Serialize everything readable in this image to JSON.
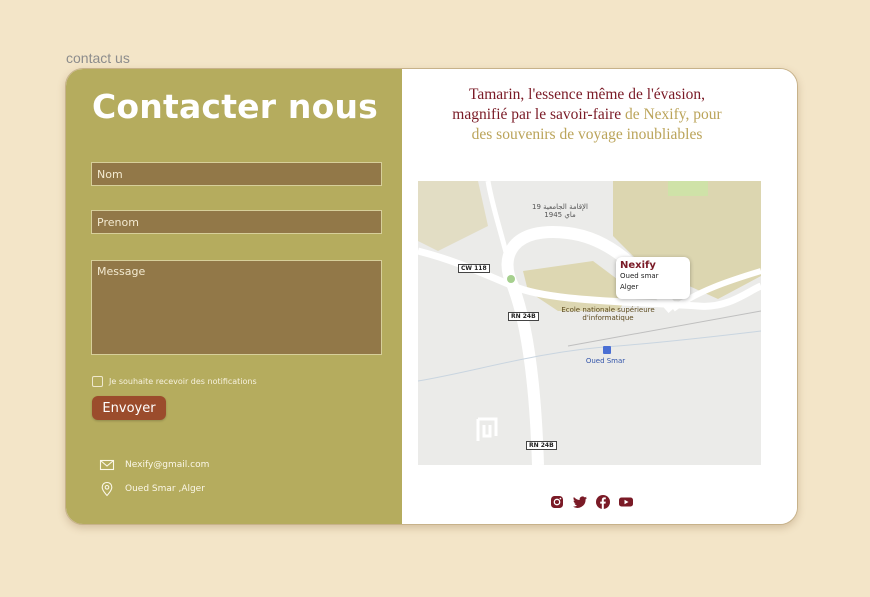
{
  "page": {
    "label": "contact us"
  },
  "form": {
    "title": "Contacter nous",
    "nom_placeholder": "Nom",
    "prenom_placeholder": "Prenom",
    "message_placeholder": "Message",
    "notify_label": "Je souhaite recevoir des notifications",
    "submit_label": "Envoyer"
  },
  "contact": {
    "email": "Nexify@gmail.com",
    "location": "Oued Smar ,Alger"
  },
  "tagline": {
    "part1": "Tamarin, l'essence même de l'évasion, magnifié par le savoir-faire",
    "part2": "de Nexify, pour des souvenirs de voyage inoubliables"
  },
  "map": {
    "popup_title": "Nexify",
    "popup_line1": "Oued smar",
    "popup_line2": "Alger",
    "place_school": "Ecole nationale supérieure d'informatique",
    "place_station": "Oued Smar",
    "place_arabic": "الإقامة الجامعية 19 ماي 1945",
    "road_cw118": "CW 118",
    "road_rn24b_1": "RN 24B",
    "road_rn24b_2": "RN 24B"
  },
  "colors": {
    "left_panel": "#b5ac5e",
    "field_bg": "#927848",
    "button": "#9b4c2c",
    "tagline_dark": "#7a1a26",
    "tagline_gold": "#bba45a"
  },
  "socials": [
    "instagram-icon",
    "twitter-icon",
    "facebook-icon",
    "youtube-icon"
  ]
}
